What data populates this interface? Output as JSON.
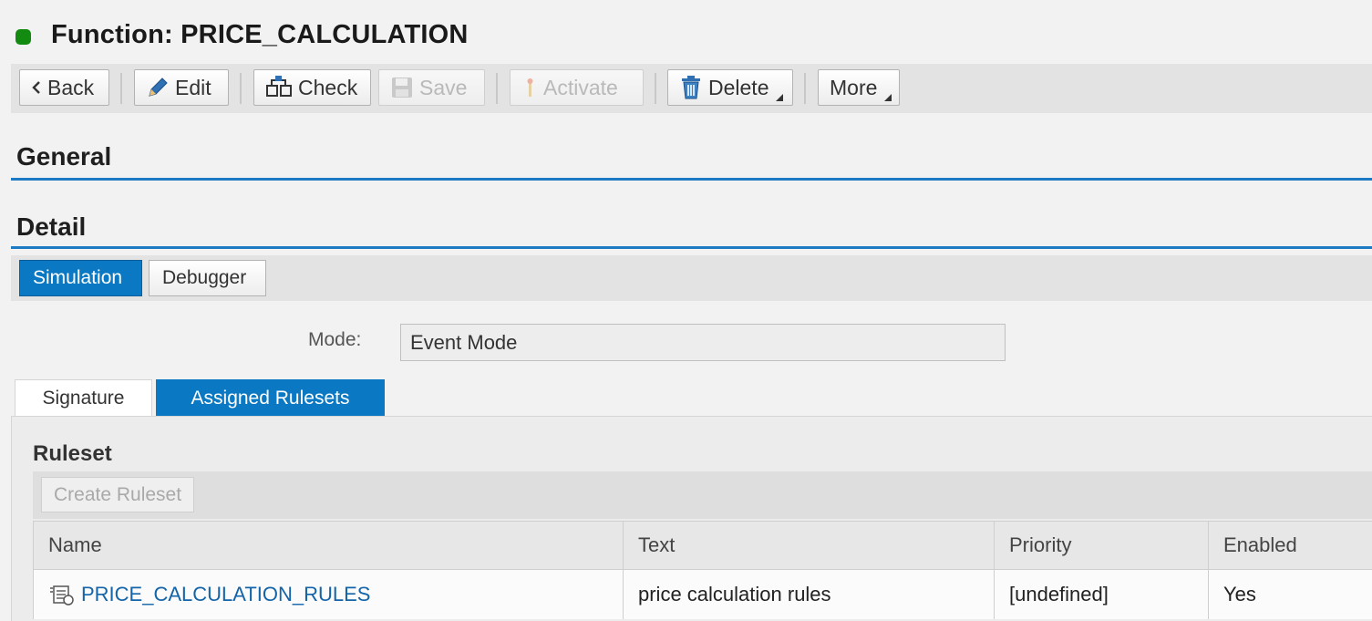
{
  "header": {
    "title": "Function: PRICE_CALCULATION",
    "status_color": "#138a10"
  },
  "toolbar": {
    "back": "Back",
    "edit": "Edit",
    "check": "Check",
    "save": "Save",
    "activate": "Activate",
    "delete": "Delete",
    "more": "More"
  },
  "sections": {
    "general": "General",
    "detail": "Detail"
  },
  "detail_tabs": {
    "simulation": "Simulation",
    "debugger": "Debugger",
    "active": "Simulation"
  },
  "mode": {
    "label": "Mode:",
    "value": "Event Mode"
  },
  "sub_tabs": {
    "signature": "Signature",
    "assigned": "Assigned Rulesets",
    "active": "Assigned Rulesets"
  },
  "ruleset": {
    "title": "Ruleset",
    "create_button": "Create Ruleset",
    "columns": [
      "Name",
      "Text",
      "Priority",
      "Enabled"
    ],
    "rows": [
      {
        "name": "PRICE_CALCULATION_RULES",
        "text": "price calculation rules",
        "priority": "[undefined]",
        "enabled": "Yes"
      }
    ]
  },
  "colors": {
    "accent": "#0a78c2",
    "section_line": "#1f7ac4",
    "link": "#1364a8"
  }
}
